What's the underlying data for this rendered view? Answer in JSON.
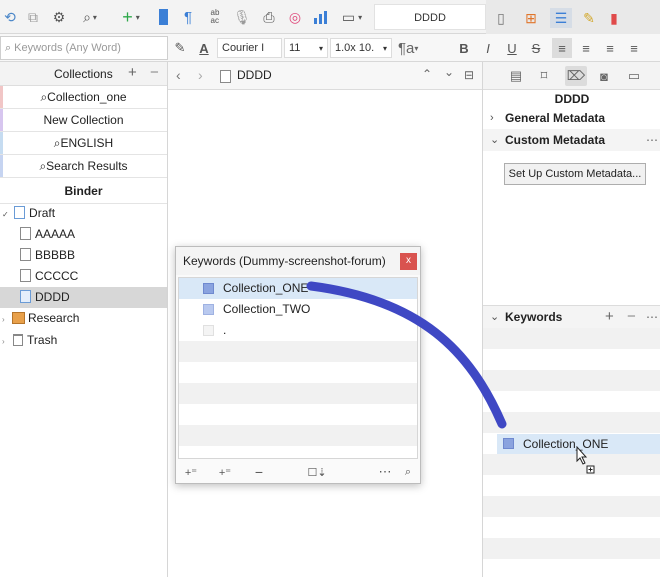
{
  "toolbar": {
    "document_title": "DDDD",
    "icons": [
      "refresh-icon",
      "sync-icon",
      "gear-icon",
      "search-icon",
      "add-icon",
      "binder-icon",
      "paragraph-icon",
      "spellcheck-icon",
      "microphone-icon",
      "print-icon",
      "target-icon",
      "chart-icon",
      "layout-icon",
      "single-view-icon",
      "grid-view-icon",
      "outline-view-icon",
      "edit-icon",
      "bookmark-icon"
    ]
  },
  "search": {
    "placeholder": "Keywords (Any Word)"
  },
  "format": {
    "font": "Courier I",
    "size": "11",
    "spacing": "1.0x 10."
  },
  "collections": {
    "header": "Collections",
    "items": [
      {
        "label": "⌕Collection_one",
        "color": "#f1c6c6"
      },
      {
        "label": "New Collection",
        "color": "#d7c6ef"
      },
      {
        "label": "⌕ENGLISH",
        "color": "#c6dcf1"
      },
      {
        "label": "⌕Search Results",
        "color": "#c6d4f1"
      }
    ],
    "binder": "Binder"
  },
  "binder": {
    "draft": "Draft",
    "docs": [
      "AAAAA",
      "BBBBB",
      "CCCCC",
      "DDDD"
    ],
    "research": "Research",
    "trash": "Trash"
  },
  "editor": {
    "title": "DDDD"
  },
  "inspector": {
    "title": "DDDD",
    "general_metadata": "General Metadata",
    "custom_metadata": "Custom Metadata",
    "setup_button": "Set Up Custom Metadata...",
    "keywords": "Keywords",
    "dragged_keyword": "Collection_ONE"
  },
  "keywords_dialog": {
    "title": "Keywords (Dummy-screenshot-forum)",
    "close": "x",
    "items": [
      "Collection_ONE",
      "Collection_TWO",
      "."
    ]
  },
  "colors": {
    "accent_stroke": "#3f48c4",
    "selection": "#d9e8f7",
    "keyword_swatch": "#8aa3df",
    "close_button": "#d9534f"
  }
}
